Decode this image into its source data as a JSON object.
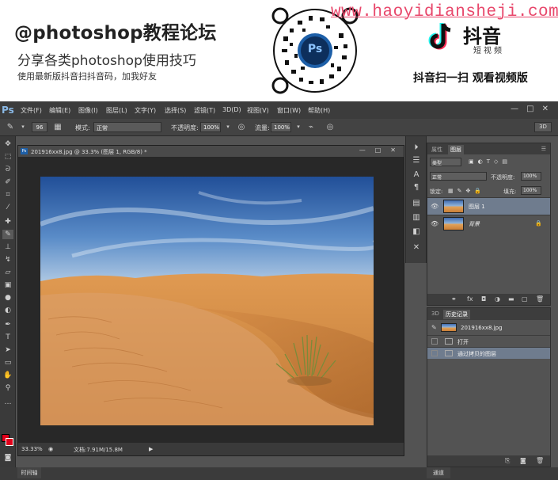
{
  "banner": {
    "title": "@photoshop教程论坛",
    "subtitle": "分享各类photoshop使用技巧",
    "instruction": "使用最新版抖音扫抖音码，加我好友",
    "url": "www.haoyidiansheji.com",
    "qr_badge": "Ps",
    "tiktok_name": "抖音",
    "tiktok_sub": "短视频",
    "tiktok_cta": "抖音扫一扫 观看视频版"
  },
  "app": {
    "logo": "Ps",
    "menu": [
      "文件(F)",
      "编辑(E)",
      "图像(I)",
      "图层(L)",
      "文字(Y)",
      "选择(S)",
      "滤镜(T)",
      "3D(D)",
      "视图(V)",
      "窗口(W)",
      "帮助(H)"
    ],
    "window_controls": [
      "—",
      "□",
      "✕"
    ]
  },
  "options": {
    "brush_size": "96",
    "mode_label": "模式:",
    "mode_value": "正常",
    "opacity_label": "不透明度:",
    "opacity_value": "100%",
    "flow_label": "流量:",
    "flow_value": "100%",
    "btn_3d": "3D"
  },
  "document": {
    "title": "201916xx8.jpg @ 33.3% (图层 1, RGB/8) *",
    "zoom": "33.33%",
    "doc_size": "文档:7.91M/15.8M"
  },
  "timeline_tab": "时间轴",
  "layers_panel": {
    "tabs": [
      "属性",
      "图层"
    ],
    "active_tab": "图层",
    "filter_label": "类型",
    "blend_mode": "正常",
    "opacity_label": "不透明度:",
    "opacity_value": "100%",
    "lock_label": "锁定:",
    "fill_label": "填充:",
    "fill_value": "100%",
    "layers": [
      {
        "name": "图层 1",
        "selected": true
      },
      {
        "name": "背景",
        "selected": false
      }
    ]
  },
  "history_panel": {
    "tabs": [
      "3D",
      "历史记录"
    ],
    "active_tab": "历史记录",
    "snapshot": "201916xx8.jpg",
    "items": [
      {
        "label": "打开",
        "selected": false
      },
      {
        "label": "通过拷贝的图层",
        "selected": true
      }
    ],
    "bottom_tab": "通道"
  },
  "colors": {
    "foreground": "#e0001b",
    "background": "#e0001b",
    "url_color": "#e8476b"
  }
}
